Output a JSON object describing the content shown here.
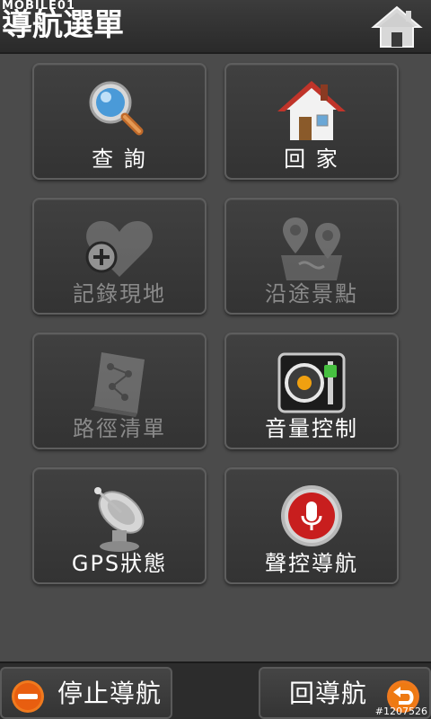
{
  "header": {
    "title": "導航選單",
    "watermark": "MOBILE01",
    "home_icon": "home-icon"
  },
  "tiles": [
    {
      "label": "查 詢",
      "icon": "magnifier-icon",
      "enabled": true
    },
    {
      "label": "回 家",
      "icon": "house-icon",
      "enabled": true
    },
    {
      "label": "記錄現地",
      "icon": "heart-add-icon",
      "enabled": false
    },
    {
      "label": "沿途景點",
      "icon": "route-poi-icon",
      "enabled": false
    },
    {
      "label": "路徑清單",
      "icon": "route-list-icon",
      "enabled": false
    },
    {
      "label": "音量控制",
      "icon": "speaker-volume-icon",
      "enabled": true
    },
    {
      "label": "GPS狀態",
      "icon": "satellite-dish-icon",
      "enabled": true
    },
    {
      "label": "聲控導航",
      "icon": "microphone-icon",
      "enabled": true
    }
  ],
  "bottom": {
    "stop_label": "停止導航",
    "stop_icon": "minus-circle-icon",
    "back_label": "回導航",
    "back_icon": "return-arrow-icon"
  },
  "photo_id": "#1207526",
  "colors": {
    "background": "#4b4b4b",
    "tile_bg": "#3a3a3a",
    "accent_orange": "#f07a1e",
    "disabled_text": "#8a8a8a"
  }
}
